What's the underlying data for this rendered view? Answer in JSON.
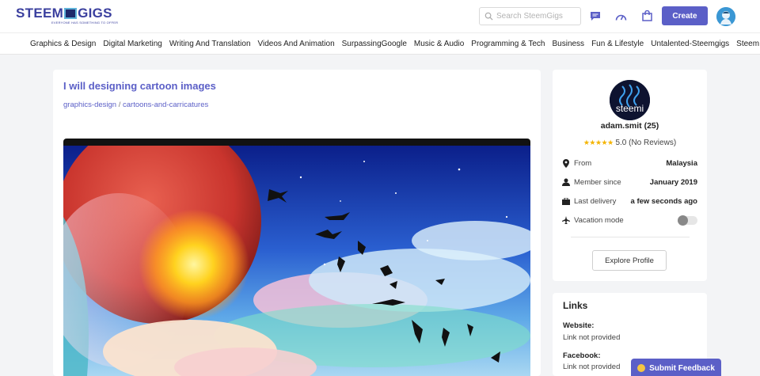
{
  "header": {
    "logo_left": "STEEM",
    "logo_right": "GIGS",
    "logo_tagline": "EVERYONE HAS SOMETHING TO OFFER",
    "search_placeholder": "Search SteemGigs",
    "create_label": "Create",
    "icons": [
      "chat-icon",
      "dashboard-icon",
      "shopping-bag-icon",
      "user-avatar"
    ]
  },
  "categories": [
    "Graphics & Design",
    "Digital Marketing",
    "Writing And Translation",
    "Videos And Animation",
    "SurpassingGoogle",
    "Music & Audio",
    "Programming & Tech",
    "Business",
    "Fun & Lifestyle",
    "Untalented-Steemgigs",
    "Steem & Steemit"
  ],
  "gig": {
    "title": "I will designing cartoon images",
    "breadcrumb": [
      "graphics-design",
      "cartoons-and-carricatures"
    ],
    "breadcrumb_sep": " / "
  },
  "profile": {
    "avatar_text": "steemi",
    "name": "adam.smit (25)",
    "stars": "★★★★★",
    "rating": "5.0 (No Reviews)",
    "rows": [
      {
        "icon": "map-pin-icon",
        "label": "From",
        "value": "Malaysia"
      },
      {
        "icon": "user-icon",
        "label": "Member since",
        "value": "January 2019"
      },
      {
        "icon": "briefcase-icon",
        "label": "Last delivery",
        "value": "a few seconds ago"
      },
      {
        "icon": "plane-icon",
        "label": "Vacation mode",
        "value": ""
      }
    ],
    "vacation_mode_on": false,
    "explore_label": "Explore Profile"
  },
  "links": {
    "title": "Links",
    "items": [
      {
        "label": "Website:",
        "value": "Link not provided"
      },
      {
        "label": "Facebook:",
        "value": "Link not provided"
      }
    ]
  },
  "feedback_label": "Submit Feedback",
  "colors": {
    "accent": "#5b5fc7",
    "star": "#f4b400",
    "background": "#f3f4f6"
  }
}
